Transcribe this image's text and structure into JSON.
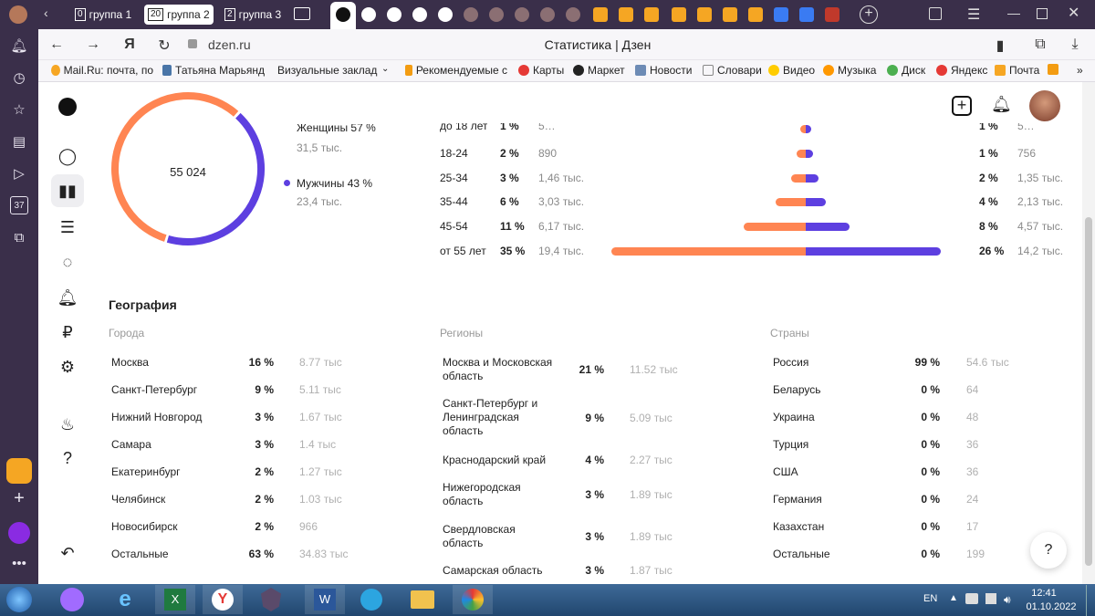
{
  "browser": {
    "tabs": [
      {
        "num": "0",
        "label": "группа 1"
      },
      {
        "num": "20",
        "label": "группа 2"
      },
      {
        "num": "2",
        "label": "группа 3"
      }
    ],
    "address": "dzen.ru",
    "page_title": "Статистика | Дзен",
    "bookmarks": [
      {
        "label": "Mail.Ru: почта, по",
        "color": "#f6a623"
      },
      {
        "label": "Татьяна Марьянд",
        "color": "#4a76a8"
      },
      {
        "label": "Визуальные заклад",
        "color": "transparent"
      },
      {
        "label": "Рекомендуемые с",
        "color": "#f39c12"
      },
      {
        "label": "Карты",
        "color": "#e53935"
      },
      {
        "label": "Маркет",
        "color": "#222"
      },
      {
        "label": "Новости",
        "color": "#6d8bb5"
      },
      {
        "label": "Словари",
        "color": "#888"
      },
      {
        "label": "Видео",
        "color": "#ffcc00"
      },
      {
        "label": "Музыка",
        "color": "#ff9800"
      },
      {
        "label": "Диск",
        "color": "#4caf50"
      },
      {
        "label": "Яндекс",
        "color": "#e53935"
      },
      {
        "label": "Почта",
        "color": "#f6a623"
      }
    ],
    "side_badge": "37"
  },
  "gender": {
    "total": "55 024",
    "women_label": "Женщины 57 %",
    "women_value": "31,5 тыс.",
    "men_label": "Мужчины 43 %",
    "men_value": "23,4 тыс.",
    "women_pct": 57,
    "men_pct": 43,
    "colors": {
      "women": "#ff8552",
      "men": "#5d3fe0"
    }
  },
  "age": {
    "rows": [
      {
        "label": "до 18 лет",
        "w_pct": "1 %",
        "w_val": "5…",
        "m_pct": "1 %",
        "m_val": "5…",
        "w_len": 1,
        "m_len": 1
      },
      {
        "label": "18-24",
        "w_pct": "2 %",
        "w_val": "890",
        "m_pct": "1 %",
        "m_val": "756",
        "w_len": 890,
        "m_len": 756
      },
      {
        "label": "25-34",
        "w_pct": "3 %",
        "w_val": "1,46 тыс.",
        "m_pct": "2 %",
        "m_val": "1,35 тыс.",
        "w_len": 1460,
        "m_len": 1350
      },
      {
        "label": "35-44",
        "w_pct": "6 %",
        "w_val": "3,03 тыс.",
        "m_pct": "4 %",
        "m_val": "2,13 тыс.",
        "w_len": 3030,
        "m_len": 2130
      },
      {
        "label": "45-54",
        "w_pct": "11 %",
        "w_val": "6,17 тыс.",
        "m_pct": "8 %",
        "m_val": "4,57 тыс.",
        "w_len": 6170,
        "m_len": 4570
      },
      {
        "label": "от 55 лет",
        "w_pct": "35 %",
        "w_val": "19,4 тыс.",
        "m_pct": "26 %",
        "m_val": "14,2 тыс.",
        "w_len": 19400,
        "m_len": 14200
      }
    ]
  },
  "geography": {
    "title": "География",
    "cities": {
      "header": "Города",
      "rows": [
        {
          "name": "Москва",
          "pct": "16 %",
          "val": "8.77 тыс"
        },
        {
          "name": "Санкт-Петербург",
          "pct": "9 %",
          "val": "5.11 тыс"
        },
        {
          "name": "Нижний Новгород",
          "pct": "3 %",
          "val": "1.67 тыс"
        },
        {
          "name": "Самара",
          "pct": "3 %",
          "val": "1.4 тыс"
        },
        {
          "name": "Екатеринбург",
          "pct": "2 %",
          "val": "1.27 тыс"
        },
        {
          "name": "Челябинск",
          "pct": "2 %",
          "val": "1.03 тыс"
        },
        {
          "name": "Новосибирск",
          "pct": "2 %",
          "val": "966"
        },
        {
          "name": "Остальные",
          "pct": "63 %",
          "val": "34.83 тыс"
        }
      ]
    },
    "regions": {
      "header": "Регионы",
      "rows": [
        {
          "name": "Москва и Московская область",
          "pct": "21 %",
          "val": "11.52 тыс"
        },
        {
          "name": "Санкт-Петербург и Ленинградская область",
          "pct": "9 %",
          "val": "5.09 тыс"
        },
        {
          "name": "Краснодарский край",
          "pct": "4 %",
          "val": "2.27 тыс"
        },
        {
          "name": "Нижегородская область",
          "pct": "3 %",
          "val": "1.89 тыс"
        },
        {
          "name": "Свердловская область",
          "pct": "3 %",
          "val": "1.89 тыс"
        },
        {
          "name": "Самарская область",
          "pct": "3 %",
          "val": "1.87 тыс"
        }
      ]
    },
    "countries": {
      "header": "Страны",
      "rows": [
        {
          "name": "Россия",
          "pct": "99 %",
          "val": "54.6 тыс"
        },
        {
          "name": "Беларусь",
          "pct": "0 %",
          "val": "64"
        },
        {
          "name": "Украина",
          "pct": "0 %",
          "val": "48"
        },
        {
          "name": "Турция",
          "pct": "0 %",
          "val": "36"
        },
        {
          "name": "США",
          "pct": "0 %",
          "val": "36"
        },
        {
          "name": "Германия",
          "pct": "0 %",
          "val": "24"
        },
        {
          "name": "Казахстан",
          "pct": "0 %",
          "val": "17"
        },
        {
          "name": "Остальные",
          "pct": "0 %",
          "val": "199"
        }
      ]
    }
  },
  "help_label": "?",
  "taskbar": {
    "lang": "EN",
    "time": "12:41",
    "date": "01.10.2022"
  }
}
